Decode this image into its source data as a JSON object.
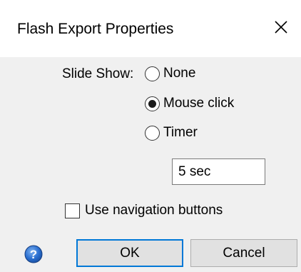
{
  "window": {
    "title": "Flash Export Properties",
    "close_icon": "close-icon"
  },
  "slideshow": {
    "label": "Slide Show:",
    "options": [
      {
        "label": "None",
        "selected": false
      },
      {
        "label": "Mouse click",
        "selected": true
      },
      {
        "label": "Timer",
        "selected": false
      }
    ],
    "timer_value": "5 sec"
  },
  "navigation": {
    "label": "Use navigation buttons",
    "checked": false
  },
  "footer": {
    "help_icon": "help-icon",
    "ok_label": "OK",
    "cancel_label": "Cancel"
  },
  "colors": {
    "dialog_bg": "#f0f0f0",
    "title_bg": "#ffffff",
    "button_bg": "#e1e1e1",
    "default_button_border": "#0078d7"
  }
}
